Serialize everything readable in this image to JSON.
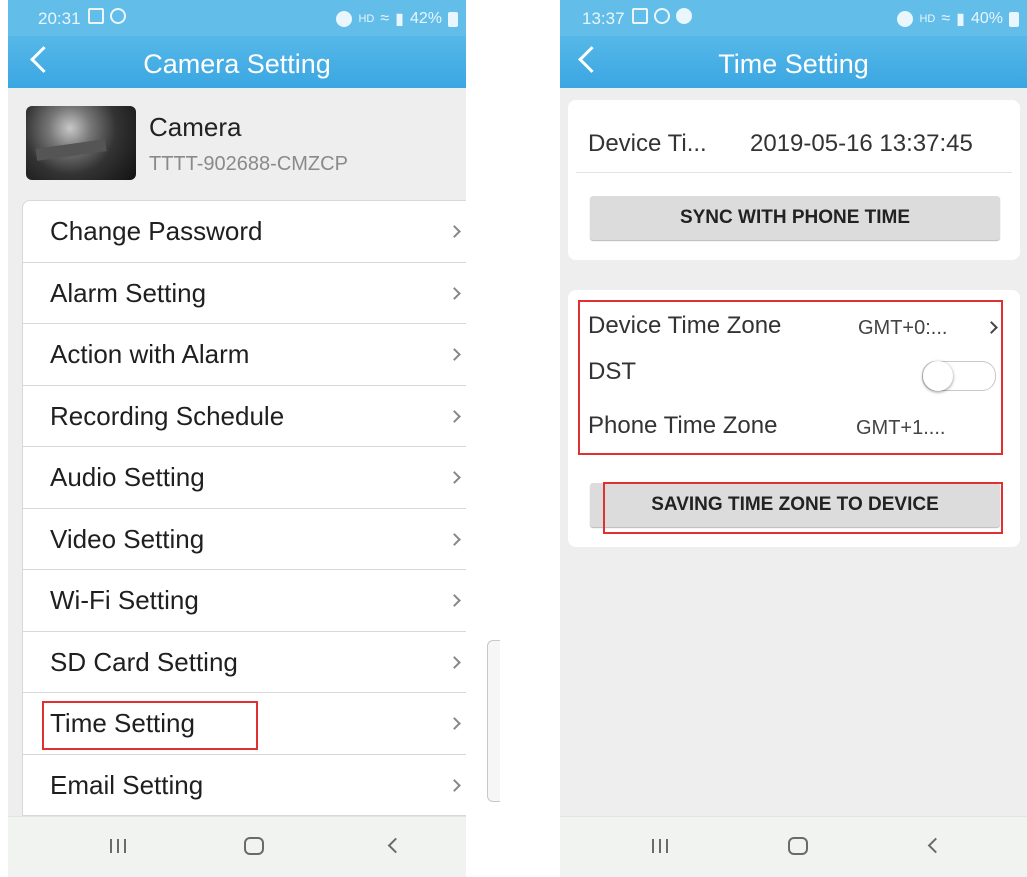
{
  "left_screen": {
    "status": {
      "time": "20:31",
      "indicators": "HD",
      "battery": "42%"
    },
    "title": "Camera Setting",
    "camera": {
      "name": "Camera",
      "id": "TTTT-902688-CMZCP"
    },
    "menu": [
      {
        "label": "Change Password"
      },
      {
        "label": "Alarm Setting"
      },
      {
        "label": "Action with Alarm"
      },
      {
        "label": "Recording Schedule"
      },
      {
        "label": "Audio Setting"
      },
      {
        "label": "Video Setting"
      },
      {
        "label": "Wi-Fi Setting"
      },
      {
        "label": "SD Card Setting"
      },
      {
        "label": "Time Setting",
        "highlighted": true
      },
      {
        "label": "Email Setting"
      }
    ]
  },
  "right_screen": {
    "status": {
      "time": "13:37",
      "indicators": "HD",
      "battery": "40%"
    },
    "title": "Time Setting",
    "device_time": {
      "label": "Device Ti...",
      "value": "2019-05-16 13:37:45"
    },
    "sync_button": "SYNC WITH PHONE TIME",
    "device_time_zone": {
      "label": "Device Time Zone",
      "value": "GMT+0:..."
    },
    "dst": {
      "label": "DST",
      "enabled": false
    },
    "phone_time_zone": {
      "label": "Phone Time Zone",
      "value": "GMT+1...."
    },
    "save_button": "SAVING TIME ZONE TO DEVICE"
  },
  "icons": {
    "status_bar": [
      "gallery-icon",
      "k-icon",
      "alarm-icon",
      "wifi-icon",
      "signal-icon",
      "battery-icon"
    ],
    "nav_bar": [
      "recents-icon",
      "home-icon",
      "back-icon"
    ]
  },
  "colors": {
    "header_blue": "#3aa6e2",
    "highlight_red": "#e03030",
    "button_grey": "#dcdcdc"
  }
}
